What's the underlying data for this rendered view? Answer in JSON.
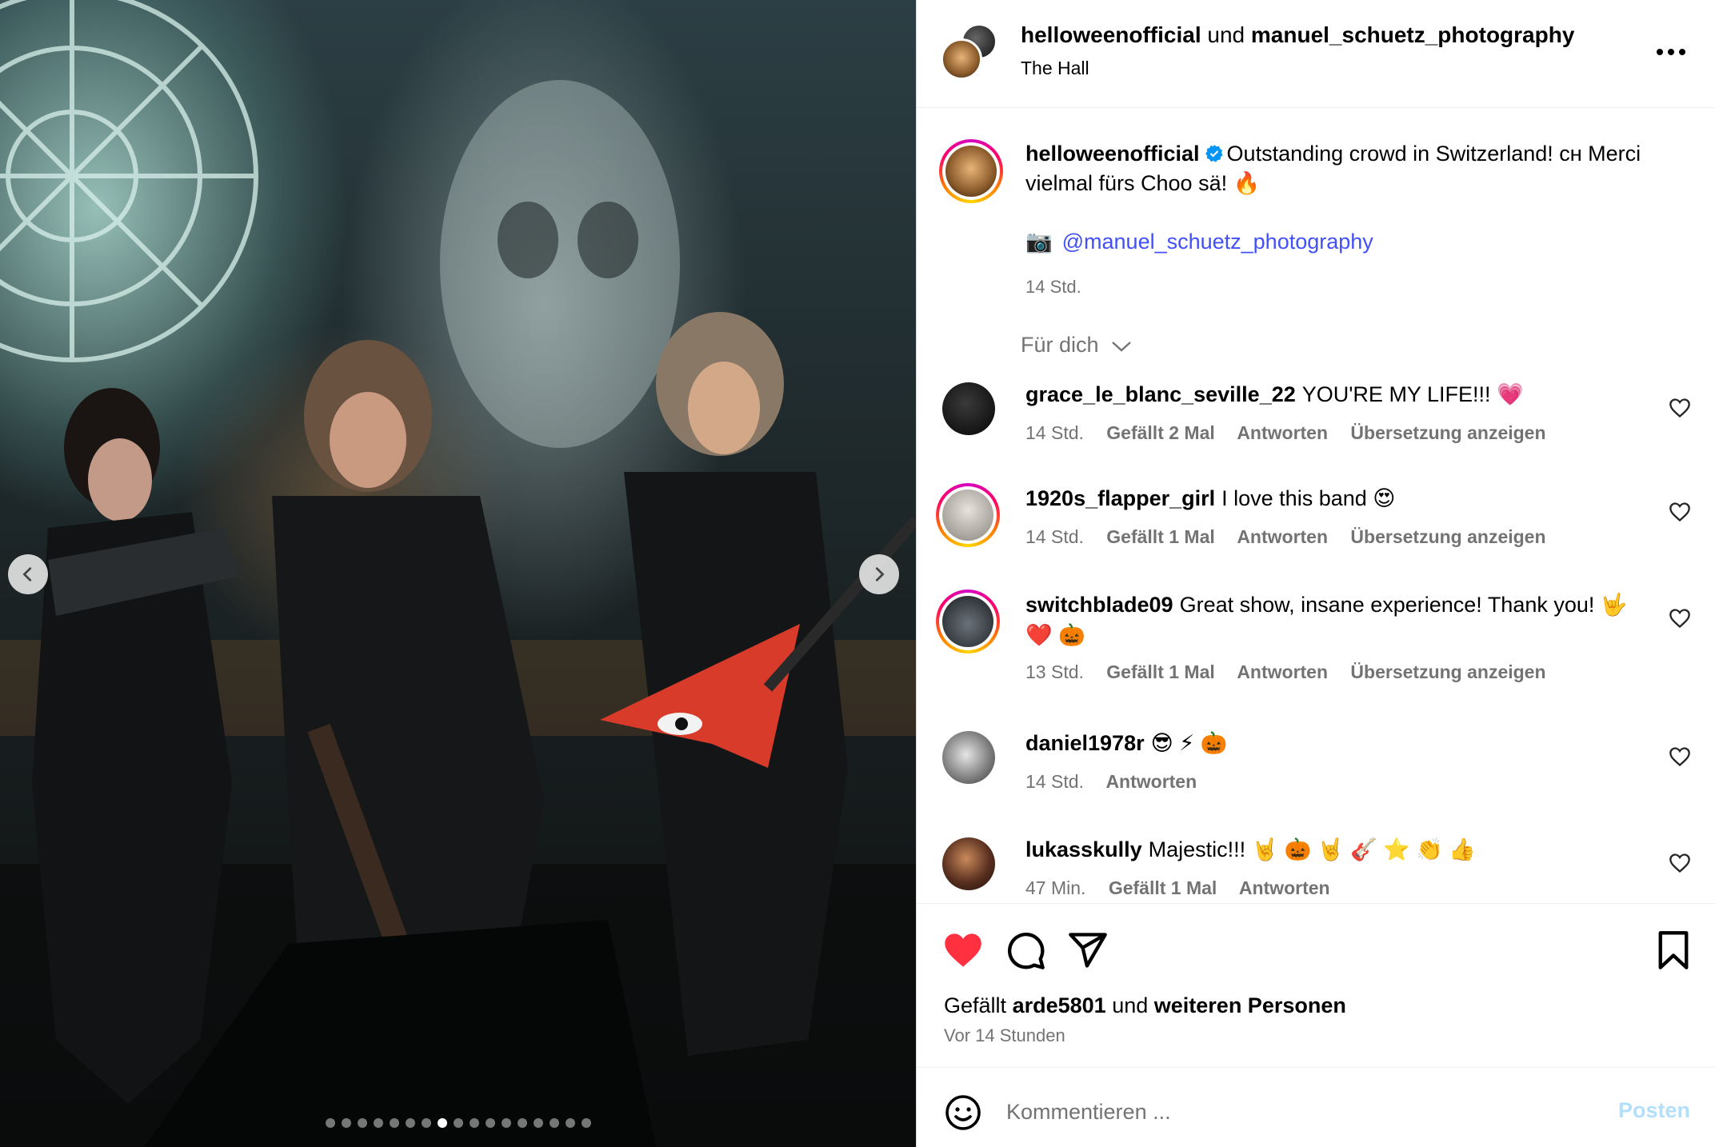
{
  "media": {
    "prev_icon": "chevron-left-icon",
    "next_icon": "chevron-right-icon",
    "dot_count": 17,
    "active_dot": 7
  },
  "header": {
    "user1": "helloweenofficial",
    "connector": "und",
    "user2": "manuel_schuetz_photography",
    "location": "The Hall",
    "more_icon": "more-horizontal-icon"
  },
  "caption": {
    "username": "helloweenofficial",
    "verified_icon": "verified-badge-icon",
    "text": "Outstanding crowd in Switzerland! ᴄʜ Merci vielmal fürs Choo sä! 🔥",
    "camera": "📷",
    "credit": "@manuel_schuetz_photography",
    "time": "14 Std."
  },
  "filter": {
    "label": "Für dich"
  },
  "comments": [
    {
      "username": "grace_le_blanc_seville_22",
      "text": "YOU'RE MY LIFE!!! 💗",
      "time": "14 Std.",
      "likes": "Gefällt 2 Mal",
      "reply": "Antworten",
      "translate": "Übersetzung anzeigen",
      "avatar_color": "#1a1a1a"
    },
    {
      "username": "1920s_flapper_girl",
      "text": "I love this band 😍",
      "time": "14 Std.",
      "likes": "Gefällt 1 Mal",
      "reply": "Antworten",
      "translate": "Übersetzung anzeigen",
      "avatar_color": "#b5b0a8"
    },
    {
      "username": "switchblade09",
      "text": "Great show, insane experience! Thank you! 🤟 ❤️ 🎃",
      "time": "13 Std.",
      "likes": "Gefällt 1 Mal",
      "reply": "Antworten",
      "translate": "Übersetzung anzeigen",
      "avatar_color": "#3a3f44"
    },
    {
      "username": "daniel1978r",
      "text": "😎 ⚡ 🎃",
      "time": "14 Std.",
      "reply": "Antworten",
      "avatar_color": "#9a9a9a"
    },
    {
      "username": "lukasskully",
      "text": "Majestic!!! 🤘 🎃 🤘 🎸 ⭐ 👏 👍",
      "time": "47 Min.",
      "likes": "Gefällt 1 Mal",
      "reply": "Antworten",
      "avatar_color": "#4a3024"
    }
  ],
  "actions": {
    "like_icon": "heart-filled-icon",
    "comment_icon": "comment-icon",
    "share_icon": "send-icon",
    "save_icon": "bookmark-icon",
    "likes_prefix": "Gefällt",
    "likes_user": "arde5801",
    "likes_connector": "und",
    "likes_others": "weiteren Personen",
    "posted": "Vor 14 Stunden",
    "like_color": "#ff3040"
  },
  "comment_bar": {
    "emoji_icon": "smiley-icon",
    "placeholder": "Kommentieren ...",
    "post_label": "Posten"
  }
}
